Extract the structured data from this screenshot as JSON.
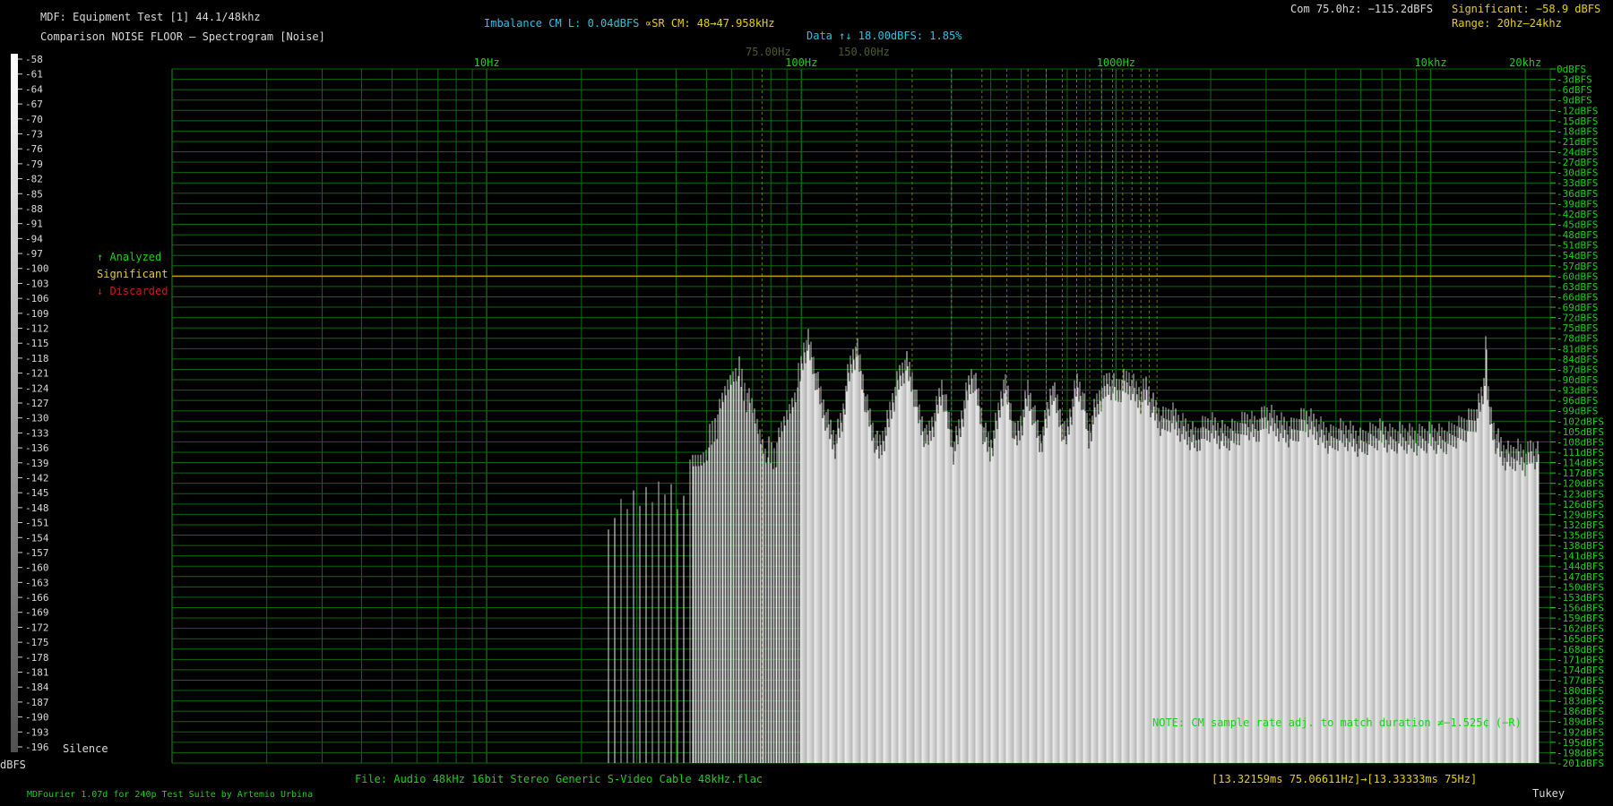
{
  "header": {
    "title": "MDF: Equipment Test [1] 44.1/48khz",
    "subtitle": "Comparison NOISE FLOOR – Spectrogram [Noise]",
    "imbalance": "Imbalance CM L: 0.04dBFS",
    "sr_cm": "∝SR CM: 48→47.958kHz",
    "data_line": "Data ↑↓ 18.00dBFS: 1.85%",
    "com": "Com 75.0hz: −115.2dBFS",
    "significant": "Significant: −58.9 dBFS",
    "range": "Range: 20hz–24khz",
    "ref_marker_1": "75.00Hz",
    "ref_marker_2": "150.00Hz"
  },
  "legend": {
    "analyzed": "↑ Analyzed",
    "significant": "Significant",
    "discarded": "↓ Discarded",
    "silence": "Silence",
    "unit": "dBFS"
  },
  "footer": {
    "file": "File: Audio   48kHz 16bit Stereo Generic S-Video Cable 48kHz.flac",
    "timing": "[13.32159ms 75.06611Hz]→[13.33333ms 75Hz]",
    "note": "NOTE: CM sample rate adj. to match duration ≠−1.525¢ (−R)",
    "credits": "MDFourier 1.07d for 240p Test Suite by Artemio Urbina",
    "window": "Tukey"
  },
  "colors": {
    "grid": "#0d6a0d",
    "label_green": "#19d119",
    "significant_line": "#b8a000",
    "marker_dashed": "#9a9a00",
    "spectrum": "#d8d8d8"
  },
  "chart_data": {
    "type": "bar",
    "x_scale": "log",
    "xlim": [
      1,
      24000
    ],
    "ylim": [
      -201,
      0
    ],
    "x_ticks": [
      {
        "hz": 10,
        "label": "10Hz"
      },
      {
        "hz": 100,
        "label": "100Hz"
      },
      {
        "hz": 1000,
        "label": "1000Hz"
      },
      {
        "hz": 10000,
        "label": "10khz"
      },
      {
        "hz": 20000,
        "label": "20khz"
      }
    ],
    "y_ticks": [
      0,
      -3,
      -6,
      -9,
      -12,
      -15,
      -18,
      -21,
      -24,
      -27,
      -30,
      -33,
      -36,
      -39,
      -42,
      -45,
      -48,
      -51,
      -54,
      -57,
      -60,
      -63,
      -66,
      -69,
      -72,
      -75,
      -78,
      -81,
      -84,
      -87,
      -90,
      -93,
      -96,
      -99,
      -102,
      -105,
      -108,
      -111,
      -114,
      -117,
      -120,
      -123,
      -126,
      -129,
      -132,
      -135,
      -138,
      -141,
      -144,
      -147,
      -150,
      -153,
      -156,
      -159,
      -162,
      -165,
      -168,
      -171,
      -174,
      -177,
      -180,
      -183,
      -186,
      -189,
      -192,
      -195,
      -198,
      -201
    ],
    "y_tick_unit": "dBFS",
    "significant_level": -60,
    "scale_bar_labels": [
      -58,
      -61,
      -64,
      -67,
      -70,
      -73,
      -76,
      -79,
      -82,
      -85,
      -88,
      -91,
      -94,
      -97,
      -100,
      -103,
      -106,
      -109,
      -112,
      -115,
      -118,
      -121,
      -124,
      -127,
      -130,
      -133,
      -136,
      -139,
      -142,
      -145,
      -148,
      -151,
      -154,
      -157,
      -160,
      -163,
      -166,
      -169,
      -172,
      -175,
      -178,
      -181,
      -184,
      -187,
      -190,
      -193,
      -196
    ],
    "series": [
      {
        "points": [
          [
            24,
            -124
          ],
          [
            26,
            -126
          ],
          [
            28,
            -122
          ],
          [
            31,
            -120
          ],
          [
            34,
            -118
          ],
          [
            37,
            -115
          ],
          [
            42,
            -120
          ],
          [
            45,
            -111
          ],
          [
            48,
            -108
          ],
          [
            51,
            -103
          ],
          [
            54,
            -98
          ],
          [
            56,
            -93
          ],
          [
            58,
            -88
          ],
          [
            60,
            -84
          ],
          [
            62,
            -81
          ],
          [
            64,
            -84
          ],
          [
            66,
            -89
          ],
          [
            70,
            -95
          ],
          [
            74,
            -101
          ],
          [
            78,
            -106
          ],
          [
            82,
            -108
          ],
          [
            86,
            -102
          ],
          [
            90,
            -96
          ],
          [
            94,
            -90
          ],
          [
            98,
            -85
          ],
          [
            100,
            -82
          ],
          [
            102,
            -77
          ],
          [
            105,
            -75
          ],
          [
            108,
            -79
          ],
          [
            112,
            -86
          ],
          [
            116,
            -92
          ],
          [
            122,
            -99
          ],
          [
            128,
            -104
          ],
          [
            135,
            -97
          ],
          [
            140,
            -86
          ],
          [
            145,
            -80
          ],
          [
            150,
            -77
          ],
          [
            155,
            -83
          ],
          [
            160,
            -92
          ],
          [
            168,
            -100
          ],
          [
            176,
            -106
          ],
          [
            185,
            -101
          ],
          [
            195,
            -92
          ],
          [
            205,
            -85
          ],
          [
            215,
            -81
          ],
          [
            225,
            -86
          ],
          [
            235,
            -95
          ],
          [
            250,
            -103
          ],
          [
            265,
            -97
          ],
          [
            280,
            -88
          ],
          [
            290,
            -95
          ],
          [
            305,
            -106
          ],
          [
            320,
            -99
          ],
          [
            335,
            -90
          ],
          [
            350,
            -84
          ],
          [
            365,
            -91
          ],
          [
            380,
            -101
          ],
          [
            400,
            -106
          ],
          [
            420,
            -97
          ],
          [
            440,
            -87
          ],
          [
            455,
            -91
          ],
          [
            480,
            -103
          ],
          [
            505,
            -97
          ],
          [
            525,
            -89
          ],
          [
            545,
            -95
          ],
          [
            575,
            -104
          ],
          [
            605,
            -96
          ],
          [
            625,
            -88
          ],
          [
            650,
            -93
          ],
          [
            690,
            -103
          ],
          [
            720,
            -95
          ],
          [
            750,
            -87
          ],
          [
            780,
            -90
          ],
          [
            820,
            -102
          ],
          [
            860,
            -94
          ],
          [
            900,
            -90
          ],
          [
            950,
            -86
          ],
          [
            1000,
            -89
          ],
          [
            1050,
            -87
          ],
          [
            1100,
            -86
          ],
          [
            1150,
            -89
          ],
          [
            1200,
            -91
          ],
          [
            1250,
            -88
          ],
          [
            1300,
            -93
          ],
          [
            1400,
            -98
          ],
          [
            1500,
            -96
          ],
          [
            1600,
            -99
          ],
          [
            1700,
            -101
          ],
          [
            1800,
            -103
          ],
          [
            1900,
            -100
          ],
          [
            2000,
            -99
          ],
          [
            2200,
            -102
          ],
          [
            2400,
            -101
          ],
          [
            2600,
            -98
          ],
          [
            2800,
            -100
          ],
          [
            3000,
            -96
          ],
          [
            3300,
            -99
          ],
          [
            3600,
            -101
          ],
          [
            4000,
            -97
          ],
          [
            4400,
            -100
          ],
          [
            4800,
            -103
          ],
          [
            5200,
            -101
          ],
          [
            5600,
            -102
          ],
          [
            6000,
            -104
          ],
          [
            6500,
            -102
          ],
          [
            7000,
            -101
          ],
          [
            7500,
            -103
          ],
          [
            8000,
            -102
          ],
          [
            9000,
            -103
          ],
          [
            10000,
            -102
          ],
          [
            11000,
            -103
          ],
          [
            12000,
            -101
          ],
          [
            13000,
            -99
          ],
          [
            14000,
            -96
          ],
          [
            14600,
            -90
          ],
          [
            14900,
            -86
          ],
          [
            15000,
            -60
          ],
          [
            15100,
            -88
          ],
          [
            15400,
            -95
          ],
          [
            16000,
            -102
          ],
          [
            17000,
            -107
          ],
          [
            18000,
            -108
          ],
          [
            19000,
            -107
          ],
          [
            20000,
            -109
          ],
          [
            21000,
            -106
          ],
          [
            22000,
            -108
          ]
        ]
      }
    ]
  }
}
